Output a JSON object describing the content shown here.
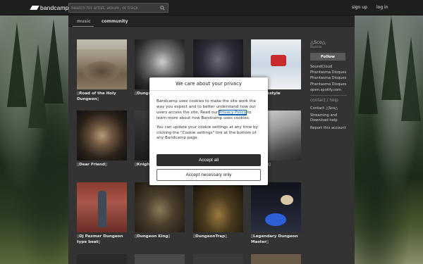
{
  "header": {
    "logo_text": "bandcamp",
    "search_placeholder": "Search for artist, album, or track",
    "signup": "sign up",
    "login": "log in"
  },
  "tabs": {
    "music": "music",
    "community": "community"
  },
  "grid": [
    {
      "caption": "▯Road of the Holy Dungeon▯"
    },
    {
      "caption": "▯Dunge"
    },
    {
      "caption": ""
    },
    {
      "caption": "ard Freestyle"
    },
    {
      "caption": "▯Dear Friend▯"
    },
    {
      "caption": "▯Knight Tales▯"
    },
    {
      "caption": ""
    },
    {
      "caption": "й шкаф▯"
    },
    {
      "caption": "▯Dj Paxmer Dungeon type beat▯"
    },
    {
      "caption": "▯Dungeon King▯"
    },
    {
      "caption": "▯DungeonTrap▯"
    },
    {
      "caption": "▯Legendary Dungeon Master▯"
    }
  ],
  "sidebar": {
    "artist_name": "△Sco△",
    "location": "Russia",
    "follow": "Follow",
    "links": [
      "SoundCloud",
      "Phantasma Disques",
      "Phantasma Disques",
      "Phantasma Disques",
      "open.spotify.com"
    ],
    "contact_heading": "contact / help",
    "contact": "Contact △Sco△",
    "streaming": "Streaming and Download help",
    "report": "Report this account"
  },
  "cookie_modal": {
    "title": "We care about your privacy",
    "p1_before": "Bandcamp uses cookies to make the site work the way you expect and to better understand how our users access the site. Read our ",
    "policy_link": "Privacy Policy",
    "p1_after": " to learn more about how Bandcamp uses cookies.",
    "p2": "You can update your cookie settings at any time by clicking the \"Cookie settings\" link at the bottom of any Bandcamp page.",
    "accept_all": "Accept all",
    "accept_necessary": "Accept necessary only"
  }
}
